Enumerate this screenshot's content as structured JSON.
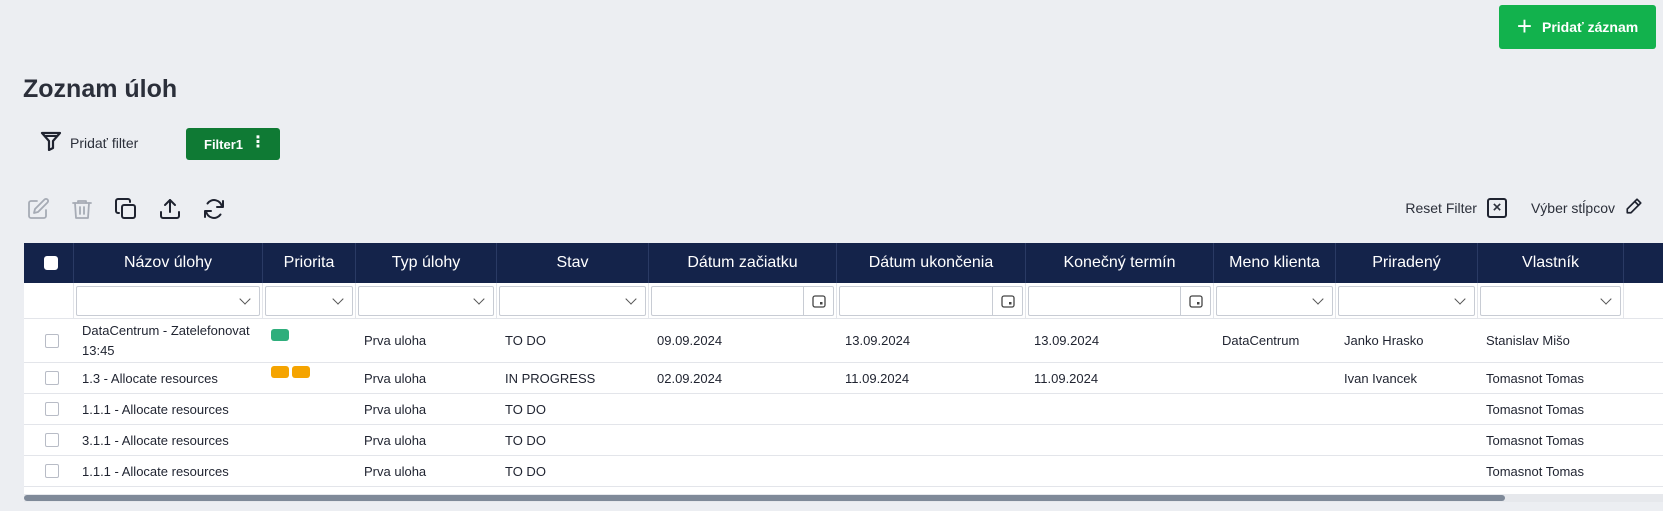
{
  "header": {
    "add_button_label": "Pridať záznam",
    "title": "Zoznam úloh"
  },
  "filters": {
    "add_filter_label": "Pridať filter",
    "active_filter": "Filter1"
  },
  "actions": {
    "reset_filter_label": "Reset Filter",
    "columns_label": "Výber stĺpcov"
  },
  "table": {
    "columns": [
      "Názov úlohy",
      "Priorita",
      "Typ úlohy",
      "Stav",
      "Dátum začiatku",
      "Dátum ukončenia",
      "Konečný termín",
      "Meno klienta",
      "Priradený",
      "Vlastník"
    ],
    "rows": [
      {
        "name": "DataCentrum - Zatelefonovat 13:45",
        "priority_colors": [
          "#2fae7c"
        ],
        "type": "Prva uloha",
        "status": "TO DO",
        "start": "09.09.2024",
        "end": "13.09.2024",
        "deadline": "13.09.2024",
        "client": "DataCentrum",
        "assigned": "Janko Hrasko",
        "owner": "Stanislav Mišo"
      },
      {
        "name": "1.3 - Allocate resources",
        "priority_colors": [
          "#f5a400",
          "#f5a400"
        ],
        "type": "Prva uloha",
        "status": "IN PROGRESS",
        "start": "02.09.2024",
        "end": "11.09.2024",
        "deadline": "11.09.2024",
        "client": "",
        "assigned": "Ivan Ivancek",
        "owner": "Tomasnot Tomas"
      },
      {
        "name": "1.1.1 - Allocate resources",
        "priority_colors": [],
        "type": "Prva uloha",
        "status": "TO DO",
        "start": "",
        "end": "",
        "deadline": "",
        "client": "",
        "assigned": "",
        "owner": "Tomasnot Tomas"
      },
      {
        "name": "3.1.1 - Allocate resources",
        "priority_colors": [],
        "type": "Prva uloha",
        "status": "TO DO",
        "start": "",
        "end": "",
        "deadline": "",
        "client": "",
        "assigned": "",
        "owner": "Tomasnot Tomas"
      },
      {
        "name": "1.1.1 - Allocate resources",
        "priority_colors": [],
        "type": "Prva uloha",
        "status": "TO DO",
        "start": "",
        "end": "",
        "deadline": "",
        "client": "",
        "assigned": "",
        "owner": "Tomasnot Tomas"
      }
    ]
  },
  "colors": {
    "primary_button": "#12b24d",
    "filter_chip": "#0f7a34",
    "table_header": "#14234a"
  },
  "icons": [
    "plus-icon",
    "funnel-icon",
    "kebab-icon",
    "edit-icon",
    "trash-icon",
    "copy-icon",
    "upload-icon",
    "refresh-icon",
    "close-box-icon",
    "pencil-icon",
    "calendar-icon",
    "chevron-down-icon"
  ]
}
